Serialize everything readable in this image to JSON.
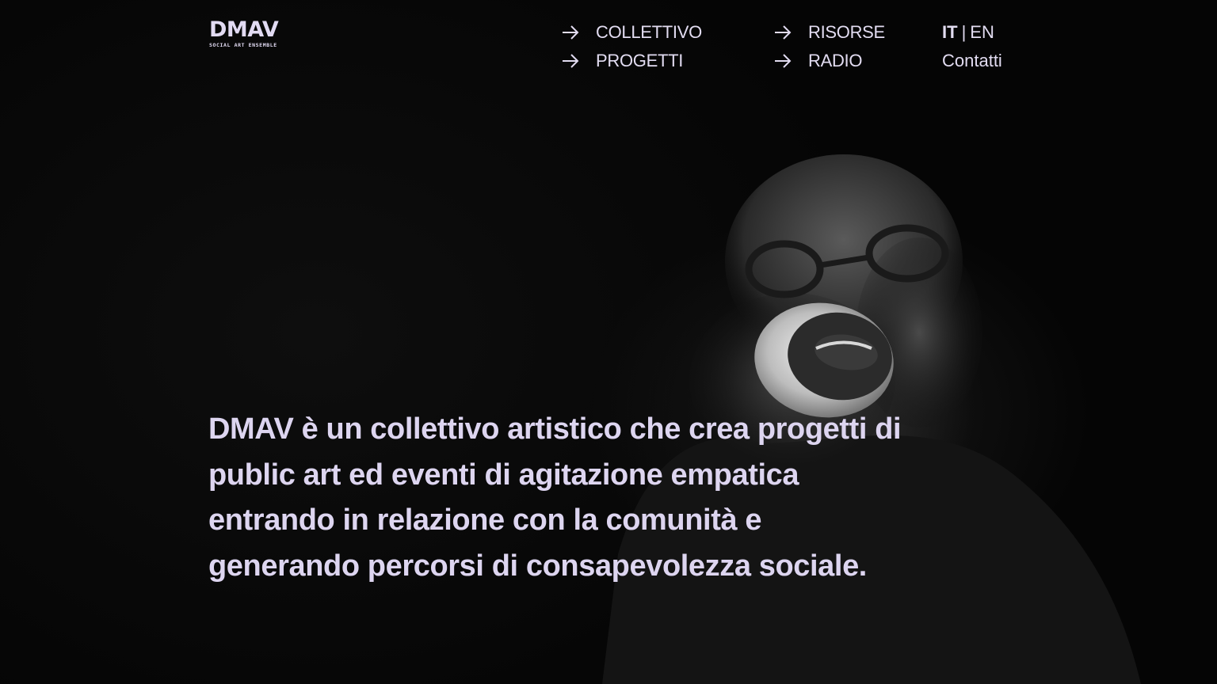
{
  "brand": {
    "name": "DMAV",
    "tagline": "SOCIAL ART ENSEMBLE"
  },
  "nav": {
    "items": [
      {
        "label": "COLLETTIVO",
        "icon": "arrow-right-icon"
      },
      {
        "label": "PROGETTI",
        "icon": "arrow-right-icon"
      },
      {
        "label": "RISORSE",
        "icon": "arrow-right-icon"
      },
      {
        "label": "RADIO",
        "icon": "arrow-right-icon"
      }
    ]
  },
  "lang": {
    "current": "IT",
    "separator": "|",
    "other": "EN"
  },
  "contact_label": "Contatti",
  "hero": {
    "text": "DMAV è un collettivo artistico che crea progetti di public art ed eventi di agitazione empatica entrando in relazione con la comunità e generando percorsi di consapevolezza sociale.",
    "image": "person-with-cup-mouth-photo"
  },
  "colors": {
    "background": "#060606",
    "text": "#e2dcf1",
    "accent": "#ddd5f0"
  }
}
